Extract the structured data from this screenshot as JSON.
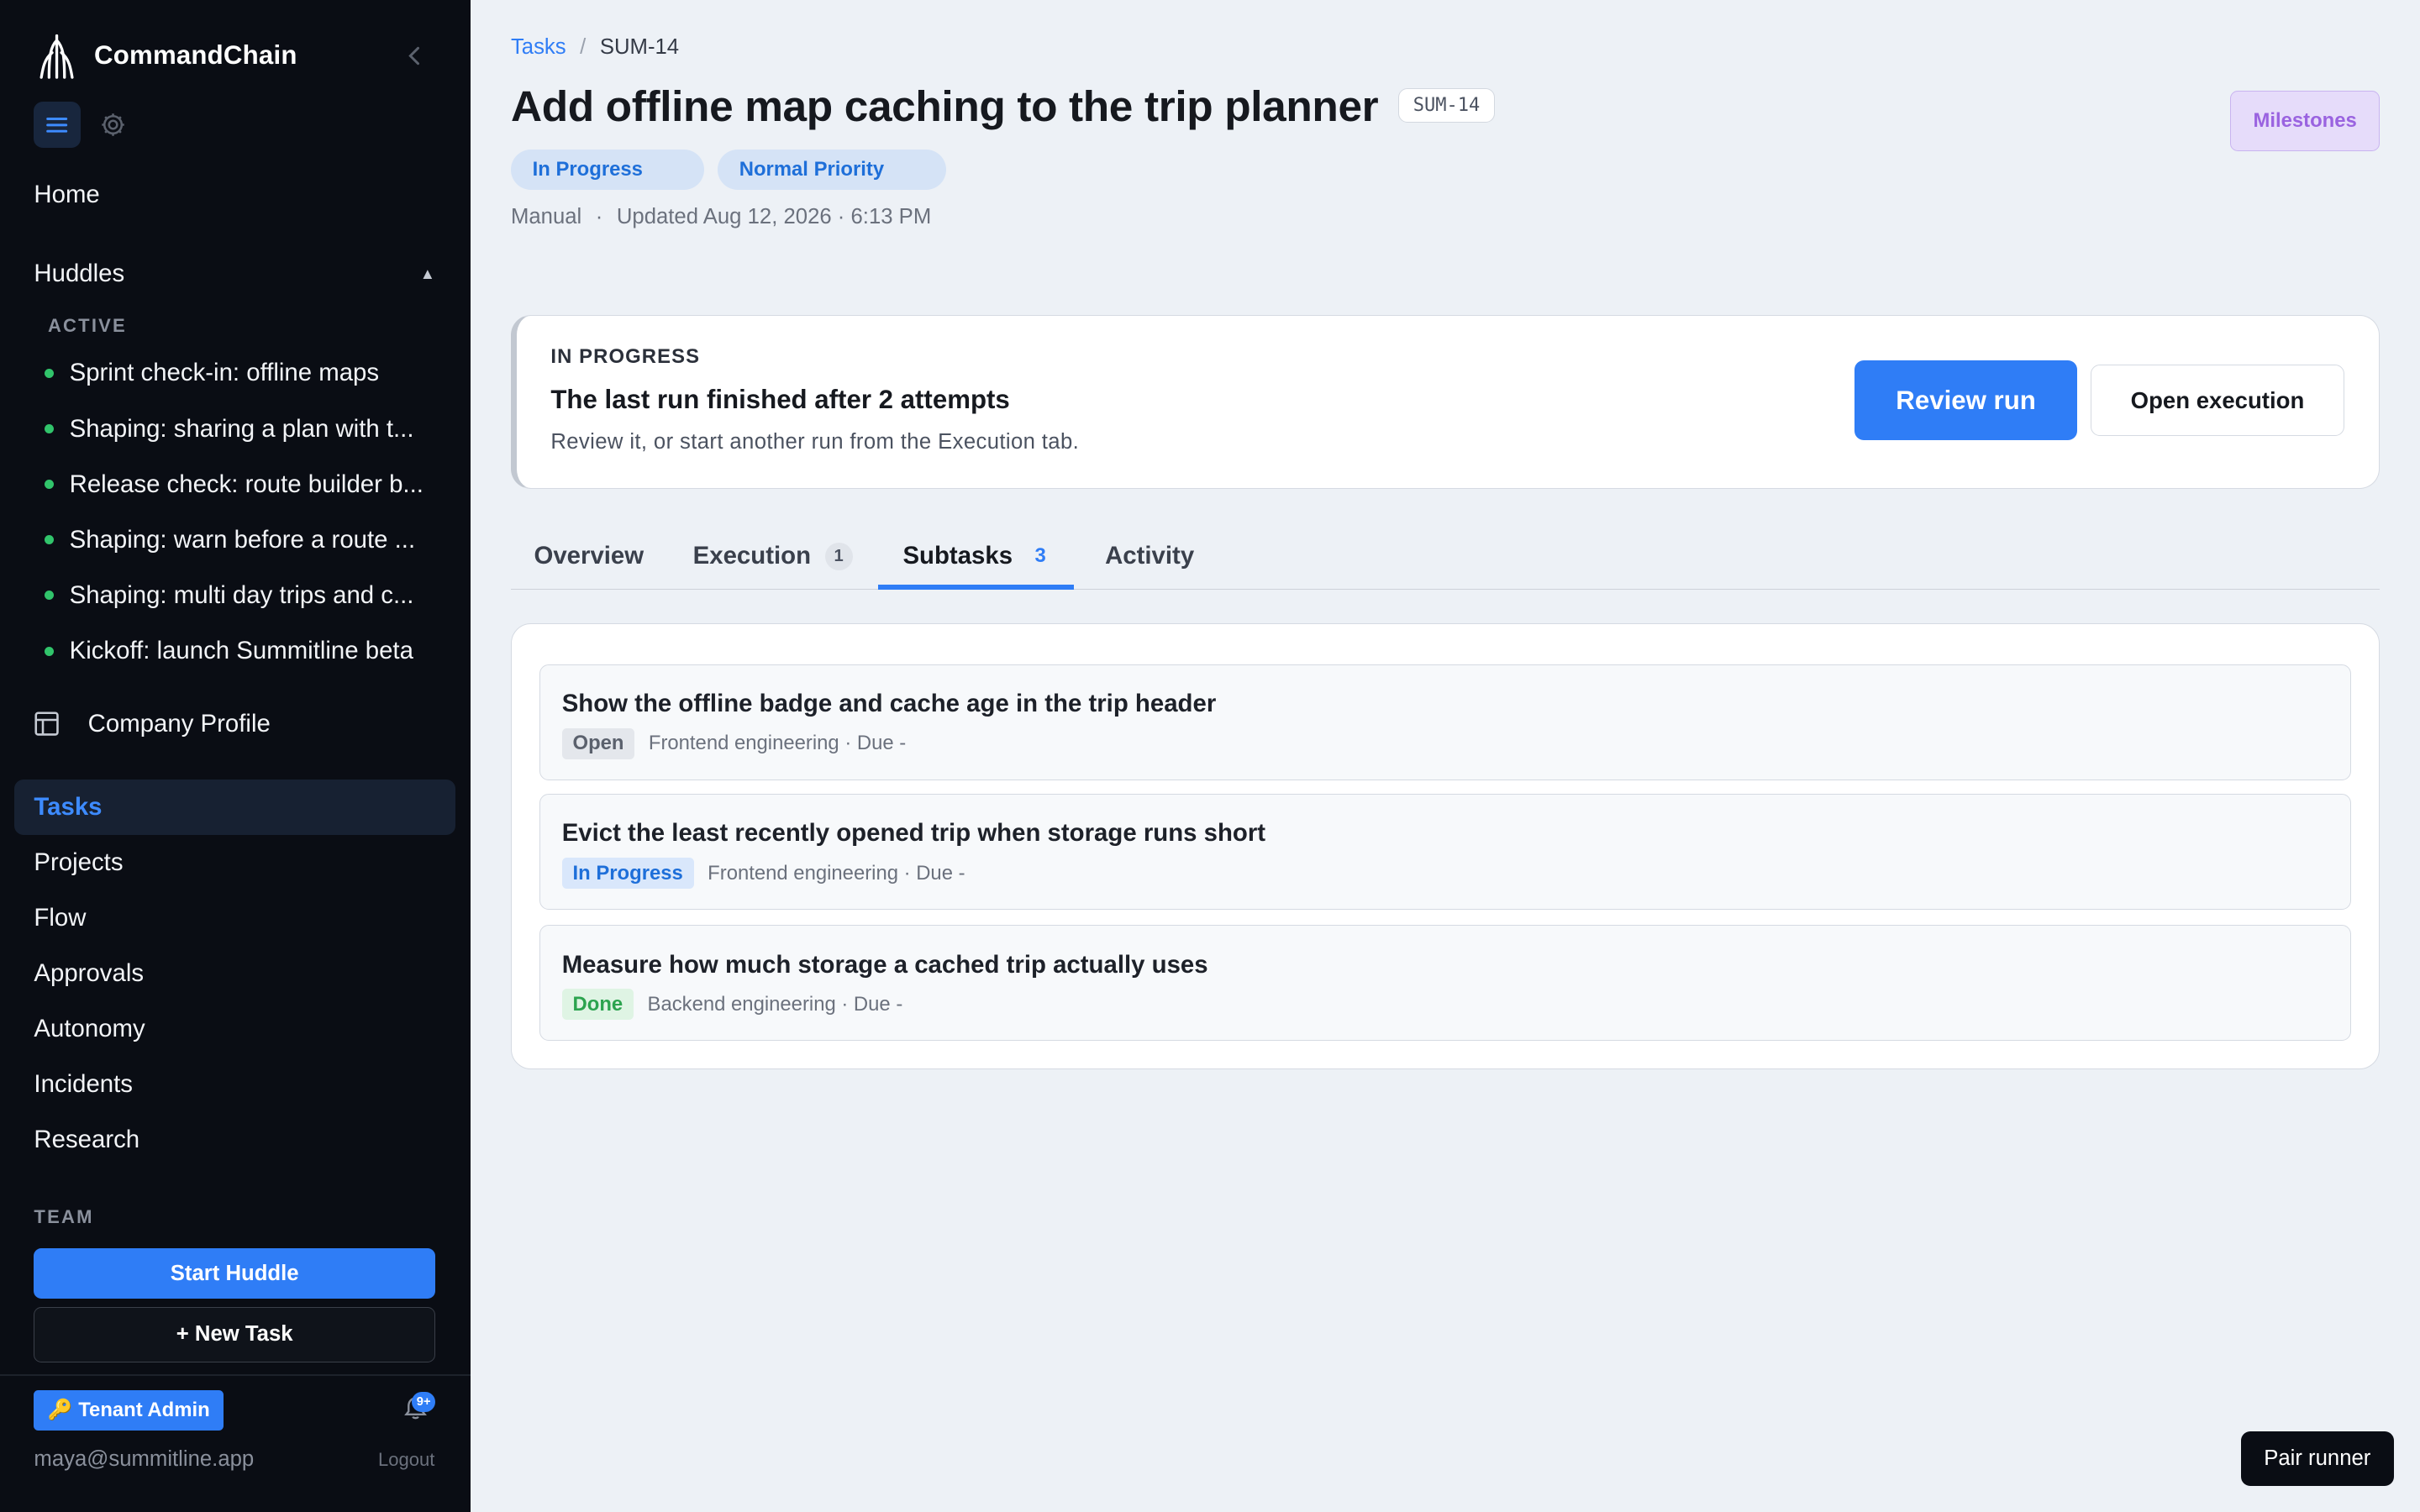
{
  "app": {
    "name": "CommandChain"
  },
  "sidebar": {
    "home": "Home",
    "huddles_label": "Huddles",
    "active_label": "ACTIVE",
    "huddles": [
      "Sprint check-in: offline maps",
      "Shaping: sharing a plan with t...",
      "Release check: route builder b...",
      "Shaping: warn before a route ...",
      "Shaping: multi day trips and c...",
      "Kickoff: launch Summitline beta"
    ],
    "company_profile": "Company Profile",
    "nav": [
      "Tasks",
      "Projects",
      "Flow",
      "Approvals",
      "Autonomy",
      "Incidents",
      "Research"
    ],
    "selected_nav": "Tasks",
    "team_label": "TEAM",
    "start_huddle": "Start Huddle",
    "new_task": "+ New Task",
    "tenant_badge": "🔑 Tenant Admin",
    "notifications_badge": "9+",
    "user_email": "maya@summitline.app",
    "logout": "Logout"
  },
  "breadcrumb": {
    "root": "Tasks",
    "separator": "/",
    "current": "SUM-14"
  },
  "task": {
    "title": "Add offline map caching to the trip planner",
    "id": "SUM-14",
    "status_pill": "In Progress",
    "priority_pill": "Normal Priority",
    "source": "Manual",
    "meta_sep": "·",
    "updated": "Updated Aug 12, 2026 · 6:13 PM"
  },
  "header_actions": {
    "milestones": "Milestones"
  },
  "run_banner": {
    "status": "IN PROGRESS",
    "title": "The last run finished after 2 attempts",
    "description": "Review it, or start another run from the Execution tab.",
    "primary_button": "Review run",
    "secondary_button": "Open execution"
  },
  "tabs": [
    {
      "label": "Overview",
      "count": ""
    },
    {
      "label": "Execution",
      "count": "1"
    },
    {
      "label": "Subtasks",
      "count": "3"
    },
    {
      "label": "Activity",
      "count": ""
    }
  ],
  "active_tab": "Subtasks",
  "subtasks": [
    {
      "title": "Show the offline badge and cache age in the trip header",
      "status": "Open",
      "meta": "Frontend engineering · Due -"
    },
    {
      "title": "Evict the least recently opened trip when storage runs short",
      "status": "In Progress",
      "meta": "Frontend engineering · Due -"
    },
    {
      "title": "Measure how much storage a cached trip actually uses",
      "status": "Done",
      "meta": "Backend engineering · Due -"
    }
  ],
  "floating": {
    "pair_runner": "Pair runner"
  },
  "colors": {
    "sidebar_bg": "#0a0d14",
    "accent": "#2f7df6",
    "page_bg": "#edf1f6",
    "huddle_dot": "#31c46b",
    "milestones": "#9a63e0",
    "done": "#2ca34f"
  },
  "icons": {
    "logo": "tree-logo-icon",
    "collapse": "chevron-left-icon",
    "menu": "hamburger-menu-icon",
    "settings": "gear-icon",
    "company": "layout-panel-icon",
    "notifications": "bell-icon"
  }
}
